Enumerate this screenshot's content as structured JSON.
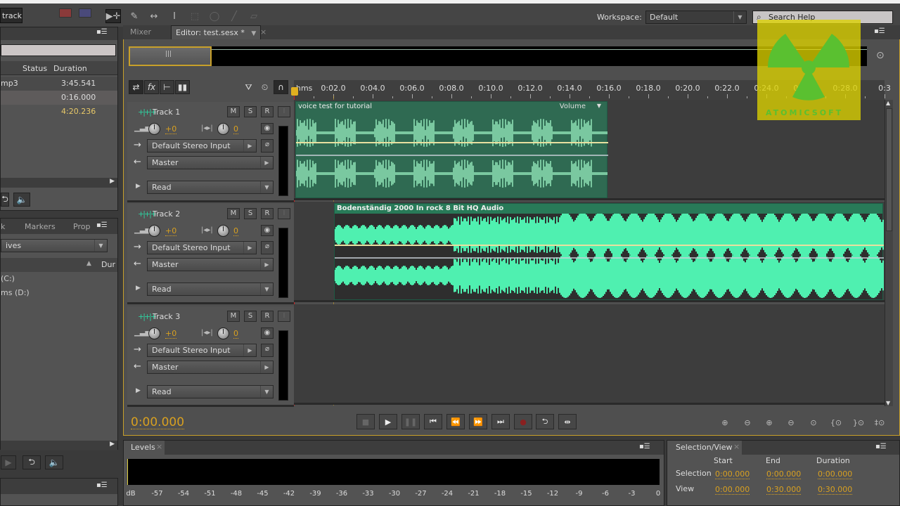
{
  "toolbar": {
    "track_label": "track",
    "tools": [
      "move-time-icon",
      "razor-icon",
      "slip-icon",
      "time-selection-icon",
      "marquee-icon",
      "lasso-icon",
      "brush-icon",
      "healing-icon"
    ],
    "workspace_label": "Workspace:",
    "workspace_value": "Default",
    "search_placeholder": "Search Help"
  },
  "files_panel": {
    "columns": [
      "Status",
      "Duration"
    ],
    "rows": [
      {
        "name": "mp3",
        "duration": "3:45.541"
      },
      {
        "name": "",
        "duration": "0:16.000"
      },
      {
        "name": "",
        "duration": "4:20.236"
      }
    ]
  },
  "media_panel": {
    "tabs": [
      "k",
      "Markers",
      "Prop"
    ],
    "dropdown": "ives",
    "column": "Dur",
    "items": [
      "(C:)",
      "ms (D:)"
    ]
  },
  "editor": {
    "tabs": [
      {
        "label": "Mixer",
        "active": false
      },
      {
        "label": "Editor: test.sesx *",
        "active": true
      }
    ],
    "ruler": {
      "unit": "hms",
      "ticks": [
        "0:02.0",
        "0:04.0",
        "0:06.0",
        "0:08.0",
        "0:10.0",
        "0:12.0",
        "0:14.0",
        "0:16.0",
        "0:18.0",
        "0:20.0",
        "0:22.0",
        "0:24.0",
        "0:26.0",
        "0:28.0",
        "0:3"
      ]
    },
    "tracks": [
      {
        "name": "Track 1",
        "mute": "M",
        "solo": "S",
        "record": "R",
        "volume": "+0",
        "pan": "0",
        "input": "Default Stereo Input",
        "output": "Master",
        "automation": "Read",
        "clip": {
          "title": "voice test for tutorial",
          "envelope": "Volume"
        }
      },
      {
        "name": "Track 2",
        "mute": "M",
        "solo": "S",
        "record": "R",
        "volume": "+0",
        "pan": "0",
        "input": "Default Stereo Input",
        "output": "Master",
        "automation": "Read",
        "clip": {
          "title": "Bodenständig 2000   In rock 8 Bit HQ Audio",
          "envelope": ""
        }
      },
      {
        "name": "Track 3",
        "mute": "M",
        "solo": "S",
        "record": "R",
        "volume": "+0",
        "pan": "0",
        "input": "Default Stereo Input",
        "output": "Master",
        "automation": "Read",
        "clip": null
      }
    ],
    "current_time": "0:00.000",
    "transport": [
      "stop",
      "play",
      "pause",
      "go-to-start",
      "rewind",
      "fast-forward",
      "go-to-end",
      "record",
      "loop",
      "skip-selection"
    ],
    "zoom_controls": [
      "zoom-in-amplitude",
      "zoom-out-amplitude",
      "zoom-in-time",
      "zoom-out-time",
      "zoom-out-full",
      "zoom-in-left",
      "zoom-in-right",
      "zoom-selection"
    ]
  },
  "levels": {
    "title": "Levels",
    "scale": [
      "dB",
      "-57",
      "-54",
      "-51",
      "-48",
      "-45",
      "-42",
      "-39",
      "-36",
      "-33",
      "-30",
      "-27",
      "-24",
      "-21",
      "-18",
      "-15",
      "-12",
      "-9",
      "-6",
      "-3",
      "0"
    ]
  },
  "selection_view": {
    "title": "Selection/View",
    "columns": [
      "Start",
      "End",
      "Duration"
    ],
    "selection_label": "Selection",
    "view_label": "View",
    "selection": {
      "start": "0:00.000",
      "end": "0:00.000",
      "duration": "0:00.000"
    },
    "view": {
      "start": "0:00.000",
      "end": "0:30.000",
      "duration": "0:30.000"
    }
  },
  "watermark": {
    "text": "ATOMICSOFT"
  },
  "colors": {
    "accent": "#d8a020",
    "waveform": "#4ff0b0",
    "clip_voice": "#2f6a52",
    "playhead": "#d02020"
  }
}
